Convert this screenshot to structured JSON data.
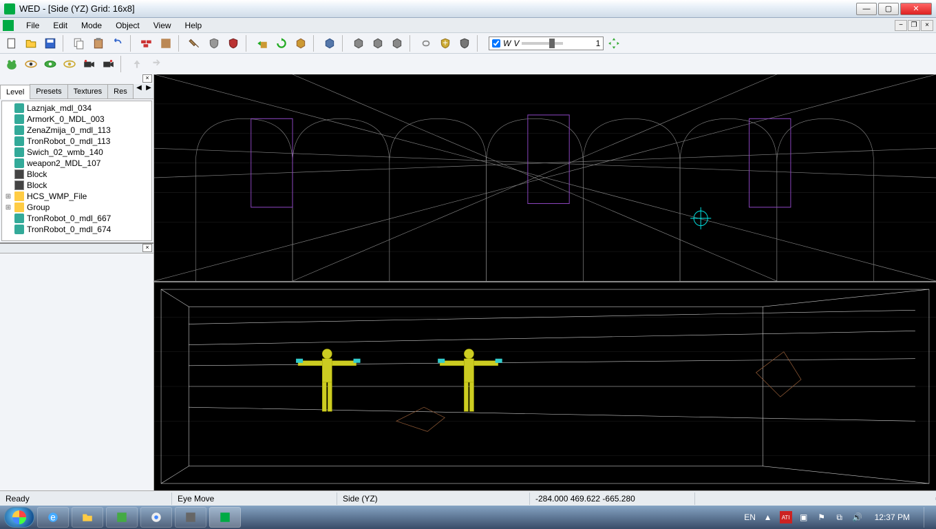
{
  "window": {
    "title": "WED - [Side (YZ) Grid: 16x8]"
  },
  "menu": {
    "items": [
      "File",
      "Edit",
      "Mode",
      "Object",
      "View",
      "Help"
    ]
  },
  "toolbar": {
    "w_checkbox_checked": true,
    "w_label1": "W",
    "w_label2": "V",
    "value_field": "1"
  },
  "sidepanel": {
    "tabs": [
      "Level",
      "Presets",
      "Textures",
      "Resources"
    ],
    "active_tab": 0,
    "tree": [
      {
        "icon": "mdl",
        "label": "Laznjak_mdl_034"
      },
      {
        "icon": "mdl",
        "label": "ArmorK_0_MDL_003"
      },
      {
        "icon": "mdl",
        "label": "ZenaZmija_0_mdl_113"
      },
      {
        "icon": "mdl",
        "label": "TronRobot_0_mdl_113"
      },
      {
        "icon": "mdl",
        "label": "Swich_02_wmb_140"
      },
      {
        "icon": "mdl",
        "label": "weapon2_MDL_107"
      },
      {
        "icon": "blk",
        "label": "Block"
      },
      {
        "icon": "blk",
        "label": "Block"
      },
      {
        "icon": "fld",
        "label": "HCS_WMP_File",
        "expandable": true
      },
      {
        "icon": "fld",
        "label": "Group",
        "expandable": true
      },
      {
        "icon": "mdl",
        "label": "TronRobot_0_mdl_667"
      },
      {
        "icon": "mdl",
        "label": "TronRobot_0_mdl_674"
      }
    ]
  },
  "status": {
    "ready": "Ready",
    "mode": "Eye Move",
    "view": "Side (YZ)",
    "coords": "-284.000 469.622 -665.280"
  },
  "systray": {
    "lang": "EN",
    "clock": "12:37 PM"
  }
}
